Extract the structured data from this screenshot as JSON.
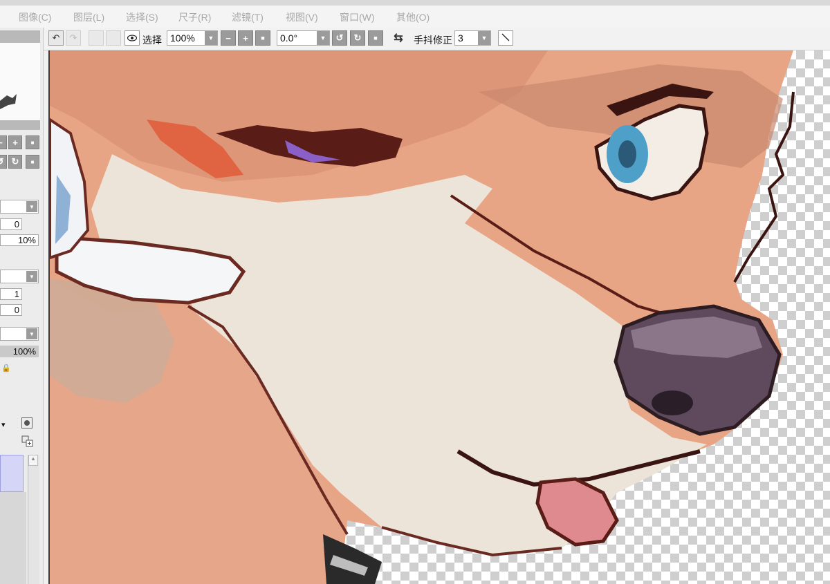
{
  "menu": [
    {
      "label": "图像(C)"
    },
    {
      "label": "图层(L)"
    },
    {
      "label": "选择(S)"
    },
    {
      "label": "尺子(R)"
    },
    {
      "label": "滤镜(T)"
    },
    {
      "label": "视图(V)"
    },
    {
      "label": "窗口(W)"
    },
    {
      "label": "其他(O)"
    }
  ],
  "toolbar": {
    "selection_label": "选择",
    "zoom_value": "100%",
    "rotation_value": "0.0°",
    "stabilizer_label": "手抖修正",
    "stabilizer_value": "3"
  },
  "left_panel": {
    "field_1": "0",
    "field_2": "10%",
    "field_3": "1",
    "field_4": "0",
    "opacity_value": "100%"
  },
  "colors": {
    "skin": "#e7a585",
    "muzzle": "#ece4d8",
    "outline": "#5a1c16",
    "nose": "#5e4a5c",
    "eye": "#4fa0c8",
    "tongue": "#de8a8e"
  },
  "icons": [
    "undo-icon",
    "redo-icon",
    "eye-icon",
    "minus-icon",
    "plus-icon",
    "rotate-left-icon",
    "rotate-right-icon",
    "flip-icon",
    "pen-line-icon",
    "lock-icon"
  ]
}
